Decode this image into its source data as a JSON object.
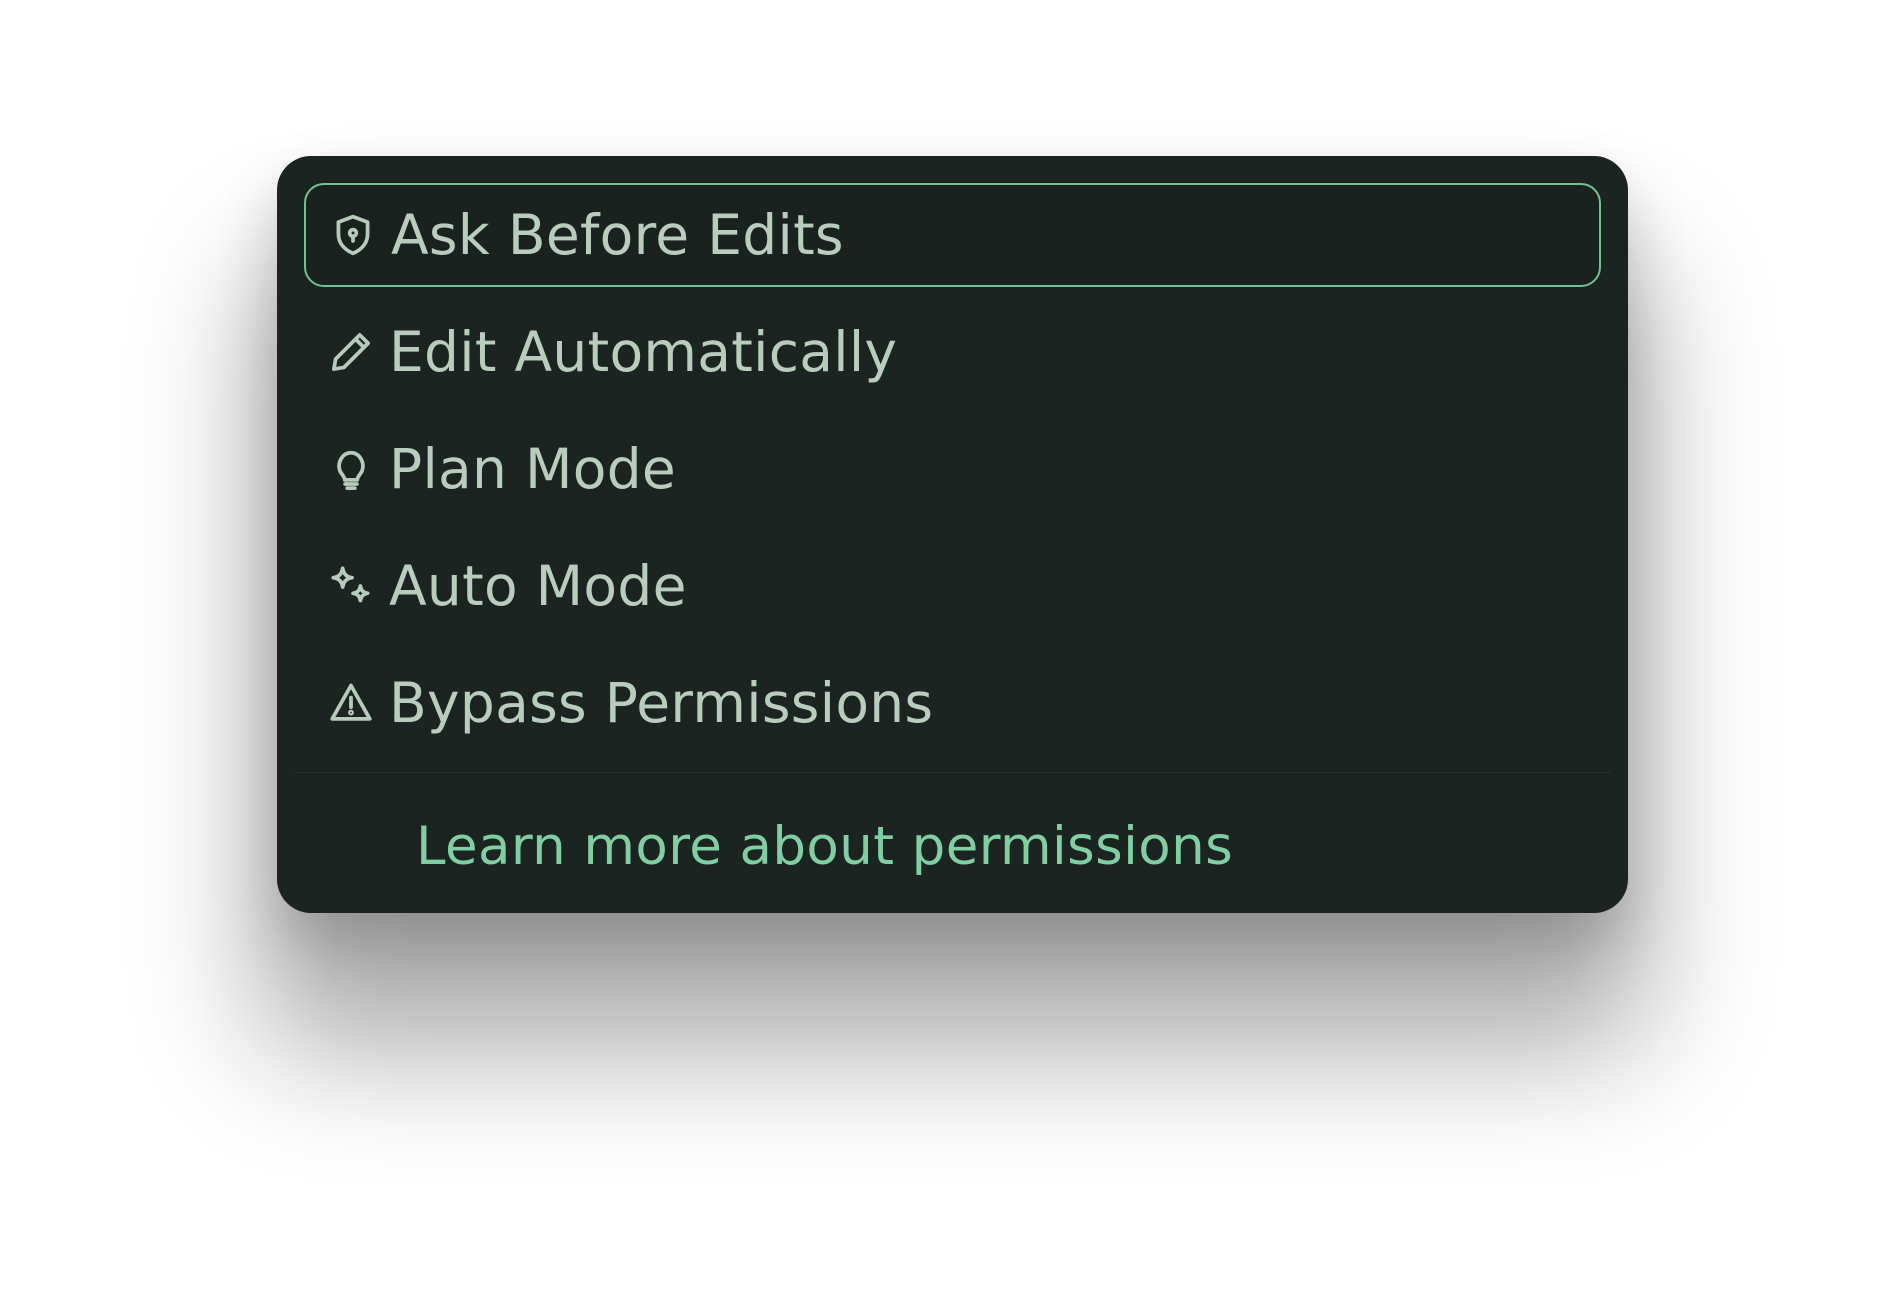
{
  "menu": {
    "items": [
      {
        "label": "Ask Before Edits",
        "icon": "shield-lock-icon",
        "selected": true
      },
      {
        "label": "Edit Automatically",
        "icon": "pencil-icon",
        "selected": false
      },
      {
        "label": "Plan Mode",
        "icon": "lightbulb-icon",
        "selected": false
      },
      {
        "label": "Auto Mode",
        "icon": "sparkles-icon",
        "selected": false
      },
      {
        "label": "Bypass Permissions",
        "icon": "warning-icon",
        "selected": false
      }
    ],
    "learn_more": "Learn more about permissions"
  },
  "colors": {
    "panel_background": "#1b2420",
    "item_text": "#b9cdbf",
    "accent": "#6fc193",
    "link": "#7fcfa2"
  }
}
